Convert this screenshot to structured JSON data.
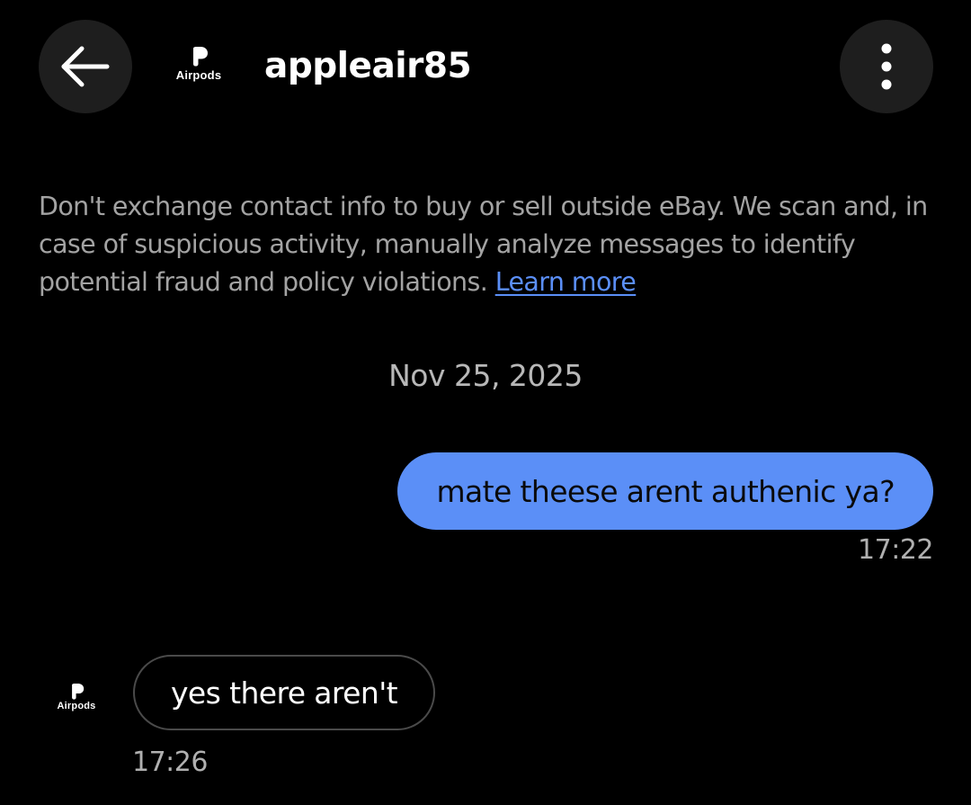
{
  "header": {
    "back_icon": "arrow-left-icon",
    "more_icon": "vertical-dots-icon",
    "avatar_logo_text": "Airpods",
    "seller_name": "appleair85"
  },
  "disclaimer": {
    "text": "Don't exchange contact info to buy or sell outside eBay. We scan and, in case of suspicious activity, manually analyze messages to identify potential fraud and policy violations.",
    "link_label": "Learn more"
  },
  "conversation": {
    "date": "Nov 25, 2025",
    "messages": [
      {
        "direction": "outgoing",
        "text": "mate theese arent authenic ya?",
        "time": "17:22"
      },
      {
        "direction": "incoming",
        "text": "yes there aren't",
        "time": "17:26",
        "avatar_logo_text": "Airpods"
      }
    ]
  },
  "colors": {
    "background": "#000000",
    "button_bg": "#1e1e1e",
    "outgoing_bubble": "#5b8ff7",
    "link": "#5b8ff7",
    "muted_text": "#a3a3a3",
    "incoming_border": "#4a4a4a"
  }
}
